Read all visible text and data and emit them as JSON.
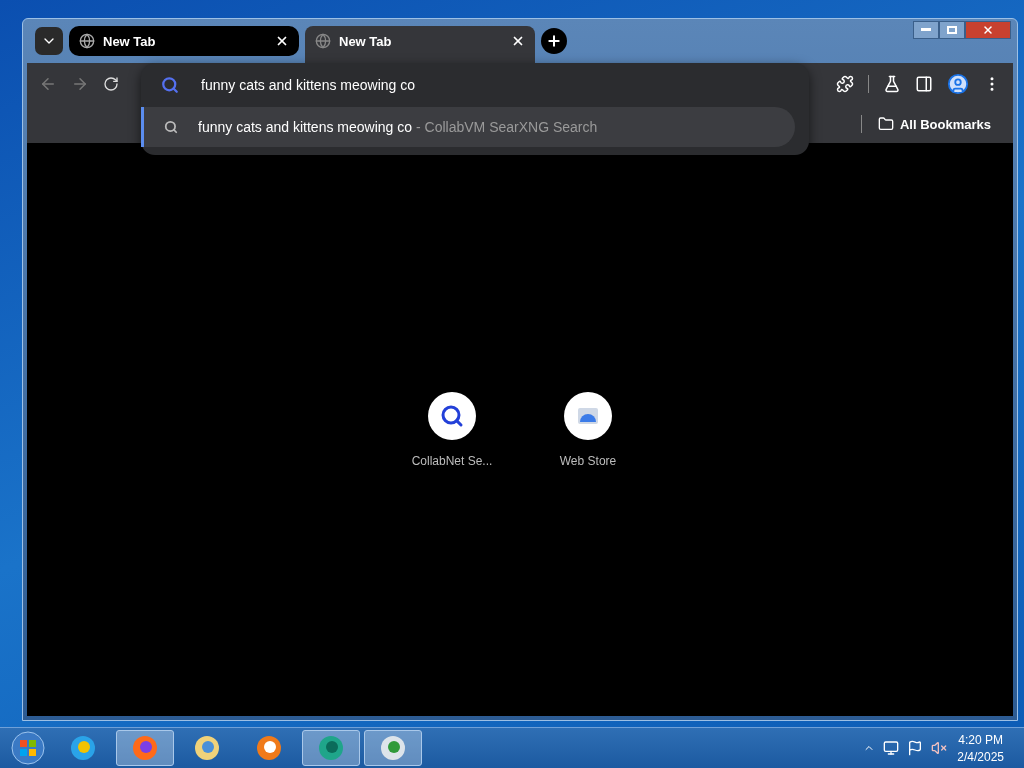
{
  "tabs": [
    {
      "title": "New Tab",
      "selected": false
    },
    {
      "title": "New Tab",
      "selected": true
    }
  ],
  "omnibox": {
    "value": "funny cats and kittens meowing co",
    "suggestion": {
      "text": "funny cats and kittens meowing co",
      "source": "- CollabVM SearXNG Search",
      "selected": true
    }
  },
  "bookmarks_bar": {
    "label": "All Bookmarks"
  },
  "shortcuts": [
    {
      "label": "CollabNet Se...",
      "kind": "search"
    },
    {
      "label": "Web Store",
      "kind": "store"
    }
  ],
  "taskbar": {
    "apps": [
      {
        "kind": "ie",
        "active": false
      },
      {
        "kind": "firefox",
        "active": true
      },
      {
        "kind": "explorer",
        "active": false
      },
      {
        "kind": "media",
        "active": false
      },
      {
        "kind": "globe",
        "active": true
      },
      {
        "kind": "monitor",
        "active": true
      }
    ],
    "clock": {
      "time": "4:20 PM",
      "date": "2/4/2025"
    }
  }
}
